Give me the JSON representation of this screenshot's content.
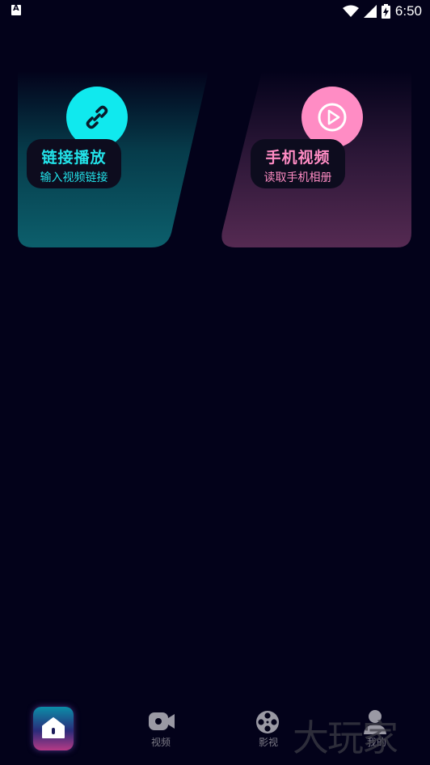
{
  "status_bar": {
    "time": "6:50",
    "notification_icon": "a-box-icon",
    "wifi_icon": "wifi-icon",
    "signal_icon": "signal-icon",
    "battery_icon": "battery-charging-icon"
  },
  "cards": [
    {
      "title": "链接播放",
      "subtitle": "输入视频链接",
      "icon": "link-icon",
      "accent": "#10e9ee"
    },
    {
      "title": "手机视频",
      "subtitle": "读取手机相册",
      "icon": "play-circle-icon",
      "accent": "#ff8cc4"
    }
  ],
  "bottom_nav": {
    "items": [
      {
        "label": "",
        "icon": "home-icon",
        "active": true
      },
      {
        "label": "视频",
        "icon": "video-camera-icon"
      },
      {
        "label": "影视",
        "icon": "film-reel-icon"
      },
      {
        "label": "我的",
        "icon": "user-icon"
      }
    ]
  },
  "watermark": "大玩家"
}
